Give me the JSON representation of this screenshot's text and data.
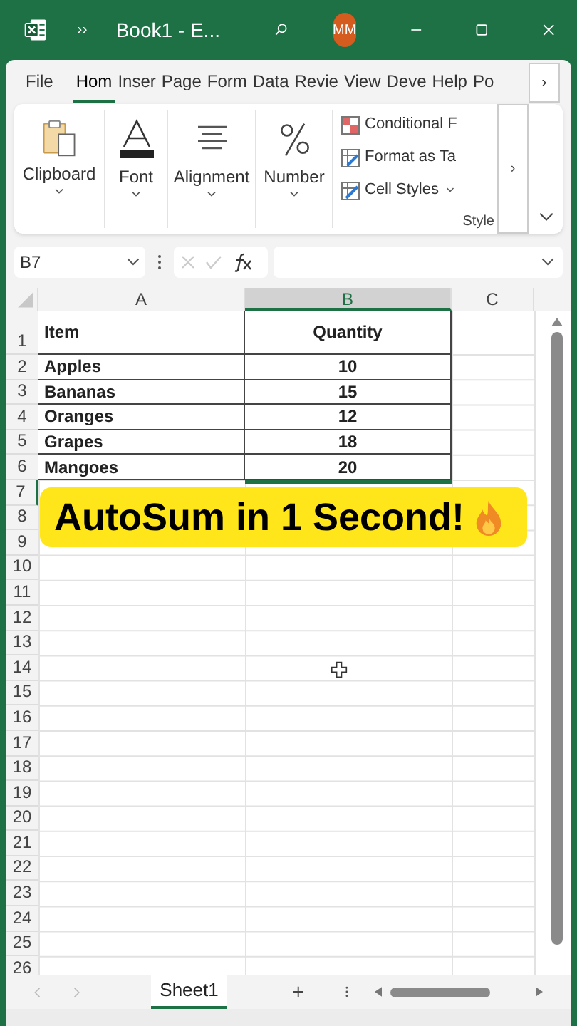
{
  "title_bar": {
    "more": "››",
    "title": "Book1  -  E...",
    "avatar": "MM"
  },
  "ribbon_tabs": [
    {
      "label": "File",
      "selected": false
    },
    {
      "label": "Hom",
      "selected": true
    },
    {
      "label": "Inser",
      "selected": false
    },
    {
      "label": "Page",
      "selected": false
    },
    {
      "label": "Form",
      "selected": false
    },
    {
      "label": "Data",
      "selected": false
    },
    {
      "label": "Revie",
      "selected": false
    },
    {
      "label": "View",
      "selected": false
    },
    {
      "label": "Deve",
      "selected": false
    },
    {
      "label": "Help",
      "selected": false
    },
    {
      "label": "Po",
      "selected": false
    }
  ],
  "tabs_scroll": "›",
  "ribbon_scroll": "›",
  "ribbon_groups": [
    {
      "kind": "clipboard",
      "label": "Clipboard"
    },
    {
      "kind": "font",
      "label": "Font"
    },
    {
      "kind": "alignment",
      "label": "Alignment"
    },
    {
      "kind": "number",
      "label": "Number"
    }
  ],
  "styles_group": {
    "items": [
      {
        "kind": "conditional",
        "label": "Conditional F"
      },
      {
        "kind": "table",
        "label": "Format as Ta"
      },
      {
        "kind": "cellstyles",
        "label": "Cell Styles"
      }
    ],
    "label": "Style"
  },
  "formula_bar": {
    "name_box": "B7"
  },
  "columns": [
    {
      "label": "A",
      "selected": false
    },
    {
      "label": "B",
      "selected": true
    },
    {
      "label": "C",
      "selected": false
    }
  ],
  "rows": [
    {
      "number": "1",
      "selected": false,
      "cells": [
        "Item",
        "Quantity"
      ]
    },
    {
      "number": "2",
      "selected": false,
      "cells": [
        "Apples",
        "10"
      ]
    },
    {
      "number": "3",
      "selected": false,
      "cells": [
        "Bananas",
        "15"
      ]
    },
    {
      "number": "4",
      "selected": false,
      "cells": [
        "Oranges",
        "12"
      ]
    },
    {
      "number": "5",
      "selected": false,
      "cells": [
        "Grapes",
        "18"
      ]
    },
    {
      "number": "6",
      "selected": false,
      "cells": [
        "Mangoes",
        "20"
      ]
    },
    {
      "number": "7",
      "selected": true
    },
    {
      "number": "8",
      "selected": false
    },
    {
      "number": "9",
      "selected": false
    },
    {
      "number": "10",
      "selected": false
    },
    {
      "number": "11",
      "selected": false
    },
    {
      "number": "12",
      "selected": false
    },
    {
      "number": "13",
      "selected": false
    },
    {
      "number": "14",
      "selected": false
    },
    {
      "number": "15",
      "selected": false
    },
    {
      "number": "16",
      "selected": false
    },
    {
      "number": "17",
      "selected": false
    },
    {
      "number": "18",
      "selected": false
    },
    {
      "number": "19",
      "selected": false
    },
    {
      "number": "20",
      "selected": false
    },
    {
      "number": "21",
      "selected": false
    },
    {
      "number": "22",
      "selected": false
    },
    {
      "number": "23",
      "selected": false
    },
    {
      "number": "24",
      "selected": false
    },
    {
      "number": "25",
      "selected": false
    },
    {
      "number": "26",
      "selected": false
    }
  ],
  "banner": {
    "text": "AutoSum in 1 Second!"
  },
  "sheet_tabs": [
    {
      "label": "Sheet1",
      "selected": true
    }
  ]
}
